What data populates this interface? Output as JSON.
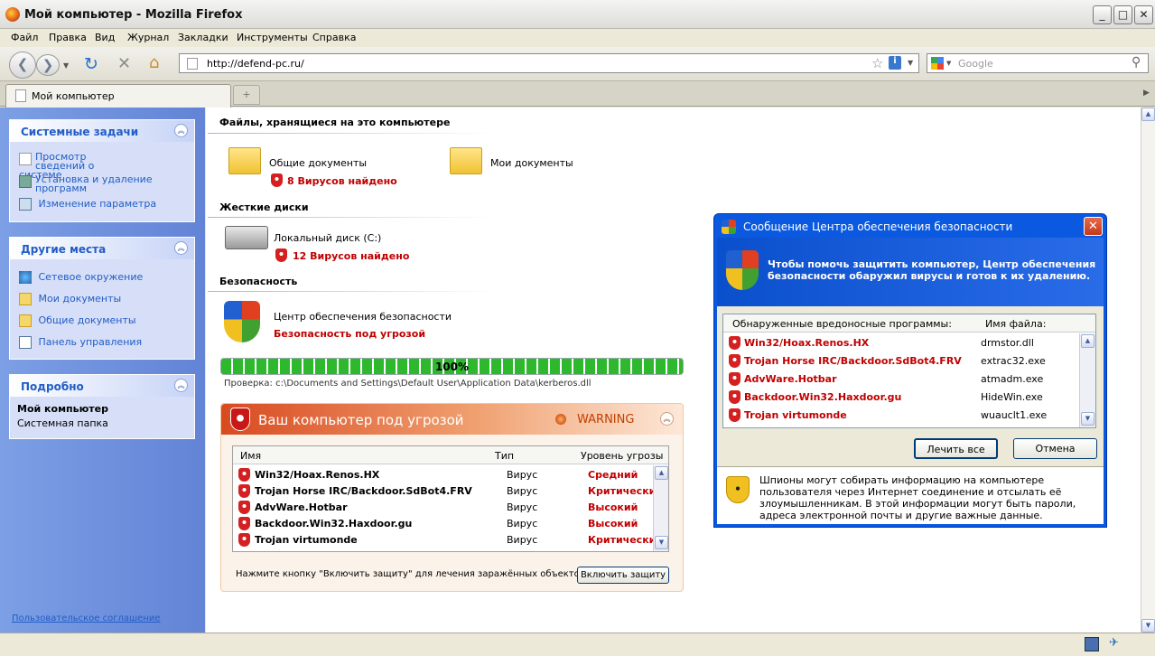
{
  "window": {
    "title": "Мой компьютер - Mozilla Firefox"
  },
  "menu": [
    "Файл",
    "Правка",
    "Вид",
    "Журнал",
    "Закладки",
    "Инструменты",
    "Справка"
  ],
  "nav": {
    "url": "http://defend-pc.ru/",
    "search_placeholder": "Google"
  },
  "tab": {
    "label": "Мой компьютер"
  },
  "sidebar": {
    "tasks": {
      "title": "Системные задачи",
      "items": [
        "Просмотр сведений о системе",
        "Установка и удаление программ",
        "Изменение параметра"
      ]
    },
    "places": {
      "title": "Другие места",
      "items": [
        "Сетевое окружение",
        "Мои документы",
        "Общие документы",
        "Панель управления"
      ]
    },
    "details": {
      "title": "Подробно",
      "name": "Мой компьютер",
      "type": "Системная папка"
    },
    "agreement": "Пользовательское соглашение"
  },
  "main": {
    "files_title": "Файлы, хранящиеся на это компьютере",
    "shared_docs": "Общие документы",
    "shared_docs_viruses": "8 Вирусов найдено",
    "my_docs": "Мои документы",
    "drives_title": "Жесткие диски",
    "local_disk": "Локальный диск (C:)",
    "local_disk_viruses": "12 Вирусов найдено",
    "security_title": "Безопасность",
    "security_center": "Центр обеспечения безопасности",
    "security_status": "Безопасность под угрозой",
    "progress": "100%",
    "scan_path": "Проверка: c:\\Documents and Settings\\Default User\\Application Data\\kerberos.dll"
  },
  "threat": {
    "title": "Ваш компьютер под угрозой",
    "warning": "WARNING",
    "columns": [
      "Имя",
      "Тип",
      "Уровень угрозы"
    ],
    "rows": [
      {
        "name": "Win32/Hoax.Renos.HX",
        "type": "Вирус",
        "level": "Средний"
      },
      {
        "name": "Trojan Horse IRC/Backdoor.SdBot4.FRV",
        "type": "Вирус",
        "level": "Критический"
      },
      {
        "name": "AdvWare.Hotbar",
        "type": "Вирус",
        "level": "Высокий"
      },
      {
        "name": "Backdoor.Win32.Haxdoor.gu",
        "type": "Вирус",
        "level": "Высокий"
      },
      {
        "name": "Trojan virtumonde",
        "type": "Вирус",
        "level": "Критический"
      }
    ],
    "hint": "Нажмите кнопку \"Включить защиту\" для лечения заражённых объектов",
    "protect_button": "Включить защиту"
  },
  "dialog": {
    "title": "Сообщение Центра обеспечения безопасности",
    "message": "Чтобы помочь защитить компьютер, Центр обеспечения безопасности обаружил вирусы и готов к их удалению.",
    "col_programs": "Обнаруженные вредоносные программы:",
    "col_file": "Имя файла:",
    "rows": [
      {
        "name": "Win32/Hoax.Renos.HX",
        "file": "drmstor.dll"
      },
      {
        "name": "Trojan Horse IRC/Backdoor.SdBot4.FRV",
        "file": "extrac32.exe"
      },
      {
        "name": "AdvWare.Hotbar",
        "file": "atmadm.exe"
      },
      {
        "name": "Backdoor.Win32.Haxdoor.gu",
        "file": "HideWin.exe"
      },
      {
        "name": "Trojan virtumonde",
        "file": "wuauclt1.exe"
      }
    ],
    "cure_button": "Лечить все",
    "cancel_button": "Отмена",
    "info": "Шпионы могут собирать информацию на компьютере пользователя через Интернет соединение и отсылать её злоумышленникам. В этой информации могут быть пароли, адреса электронной почты и другие важные данные."
  }
}
